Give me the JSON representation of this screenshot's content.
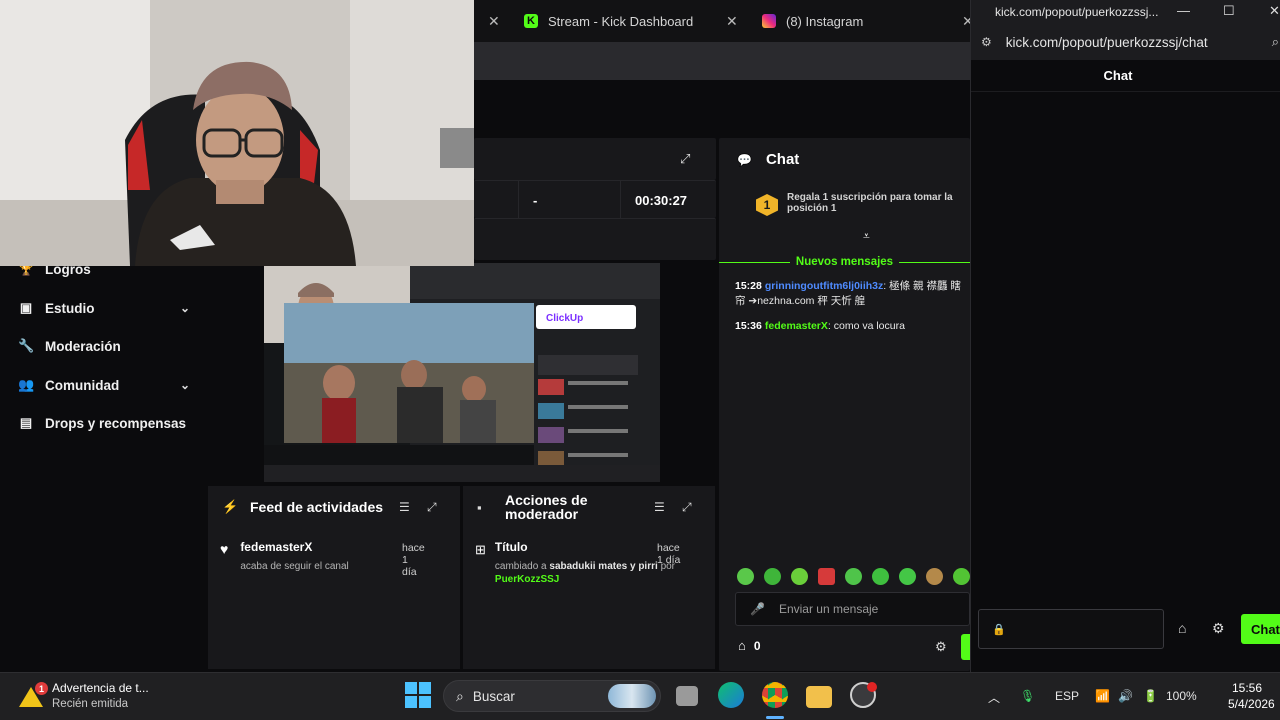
{
  "browser": {
    "tabs": [
      {
        "label": "Stream - Kick Dashboard",
        "icon": "kick-logo-icon"
      },
      {
        "label": "(8) Instagram",
        "icon": "instagram-icon"
      }
    ]
  },
  "stats": {
    "dash": "-",
    "duration": "00:30:27"
  },
  "sidebar": {
    "items": [
      {
        "label": "Logros",
        "icon": "trophy-icon"
      },
      {
        "label": "Estudio",
        "icon": "studio-icon",
        "expandable": true
      },
      {
        "label": "Moderación",
        "icon": "wrench-icon"
      },
      {
        "label": "Comunidad",
        "icon": "people-icon",
        "expandable": true
      },
      {
        "label": "Drops y recompensas",
        "icon": "gift-icon"
      }
    ]
  },
  "feed": {
    "title": "Feed de actividades",
    "entry": {
      "user": "fedemasterX",
      "time": "hace 1 día",
      "desc": "acaba de seguir el canal"
    }
  },
  "modactions": {
    "title": "Acciones de moderador",
    "entry": {
      "title": "Título",
      "time": "hace 1 día",
      "desc_prefix": "cambiado a",
      "value": "sabadukii mates y pirri",
      "by": "por",
      "user": "PuerKozzSSJ"
    }
  },
  "chat": {
    "title": "Chat",
    "subgoal_rank": "1",
    "subgoal_text": "Regala 1 suscripción para tomar la posición 1",
    "new_messages": "Nuevos mensajes",
    "messages": [
      {
        "time": "15:28",
        "user": "grinningoutfitm6lj0iih3z",
        "text": "極條 親 襟龘 瞎 帘 ➔nezhna.com 秤 天忻 艎",
        "color": "#4f8bff"
      },
      {
        "time": "15:36",
        "user": "fedemasterX",
        "text": "como va locura",
        "color": "#53fc18"
      }
    ],
    "input_placeholder": "Enviar un mensaje",
    "points": "0"
  },
  "popout": {
    "window_title": "kick.com/popout/puerkozzssj...",
    "url": "kick.com/popout/puerkozzssj/chat",
    "chat_title": "Chat",
    "send_label": "Chat"
  },
  "taskbar": {
    "notif_count": "1",
    "notif_title": "Advertencia de t...",
    "notif_sub": "Recién emitida",
    "search_label": "Buscar",
    "lang": "ESP",
    "battery": "100%",
    "time": "15:56",
    "date": "5/4/2026"
  },
  "colors": {
    "kick_green": "#53fc18",
    "panel": "#18181b",
    "background": "#0b0b0d"
  }
}
